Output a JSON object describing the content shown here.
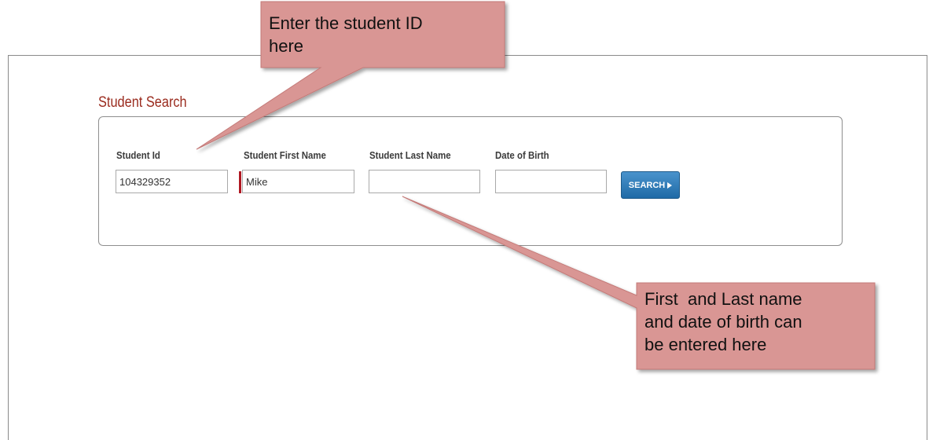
{
  "form": {
    "title": "Student Search",
    "fields": [
      {
        "label": "Student Id",
        "value": "104329352",
        "placeholder": ""
      },
      {
        "label": "Student First Name",
        "value": "Mike",
        "placeholder": ""
      },
      {
        "label": "Student Last Name",
        "value": "",
        "placeholder": ""
      },
      {
        "label": "Date of Birth",
        "value": "",
        "placeholder": ""
      }
    ],
    "search_label": "SEARCH"
  },
  "callouts": {
    "top": {
      "line1": "Enter the student ID",
      "line2": "here"
    },
    "bottom": {
      "line1": "First  and Last name",
      "line2": "and date of birth can",
      "line3": "be entered here"
    }
  },
  "colors": {
    "title": "#9a2b1e",
    "callout_fill": "#d99694",
    "required_marker": "#b01923",
    "button": "#2a78b5"
  },
  "icons": {
    "search_button_arrow": "play-triangle-icon"
  }
}
